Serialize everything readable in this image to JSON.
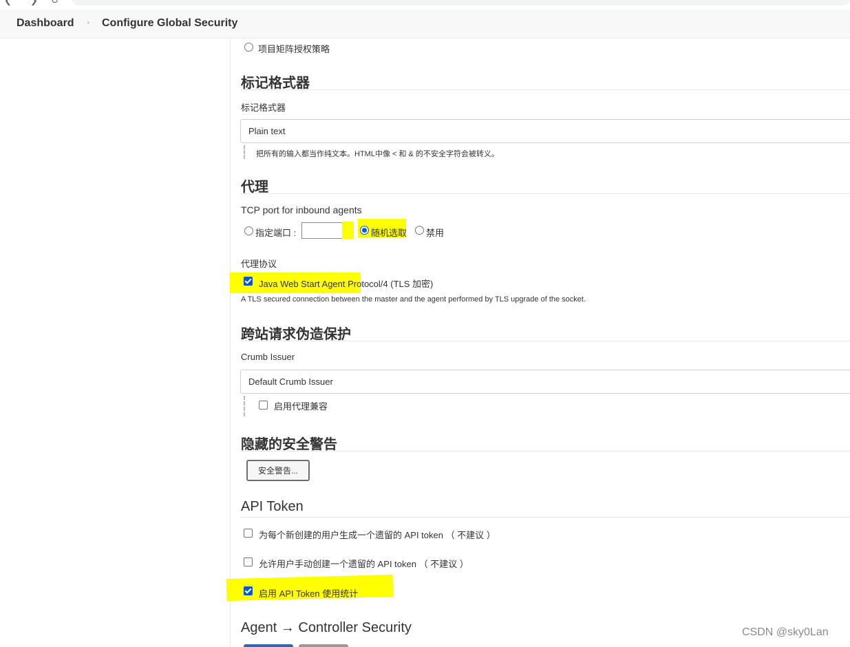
{
  "breadcrumb": {
    "dashboard": "Dashboard",
    "separator": "›",
    "current": "Configure Global Security"
  },
  "authorization": {
    "project_matrix_option": "项目矩阵授权策略"
  },
  "markup_formatter": {
    "heading": "标记格式器",
    "field_label": "标记格式器",
    "selected": "Plain text",
    "help": "把所有的输入都当作纯文本。HTML中像 < 和 & 的不安全字符会被转义。"
  },
  "agents": {
    "heading": "代理",
    "tcp_label": "TCP port for inbound agents",
    "fixed_port_label": "指定端口 :",
    "fixed_port_value": "",
    "random_label": "随机选取",
    "disable_label": "禁用",
    "selected": "random",
    "protocols_label": "代理协议",
    "protocol_name": "Java Web Start Agent Protocol/4 (TLS 加密)",
    "protocol_checked": true,
    "protocol_desc": "A TLS secured connection between the master and the agent performed by TLS upgrade of the socket."
  },
  "csrf": {
    "heading": "跨站请求伪造保护",
    "issuer_label": "Crumb Issuer",
    "issuer_selected": "Default Crumb Issuer",
    "proxy_compat_label": "启用代理兼容",
    "proxy_compat_checked": false
  },
  "hidden_warnings": {
    "heading": "隐藏的安全警告",
    "button": "安全警告..."
  },
  "api_token": {
    "heading": "API Token",
    "options": [
      {
        "label": "为每个新创建的用户生成一个遗留的 API token （ 不建议 ）",
        "checked": false
      },
      {
        "label": "允许用户手动创建一个遗留的 API token （ 不建议 ）",
        "checked": false
      },
      {
        "label": "启用 API Token 使用统计",
        "checked": true
      }
    ]
  },
  "agent_controller": {
    "heading": "Agent → Controller Security"
  },
  "watermark": "CSDN @sky0Lan",
  "colors": {
    "highlight": "#ffff00",
    "accent": "#0b57d0",
    "breadcrumb_bg": "#f8f8f8"
  }
}
